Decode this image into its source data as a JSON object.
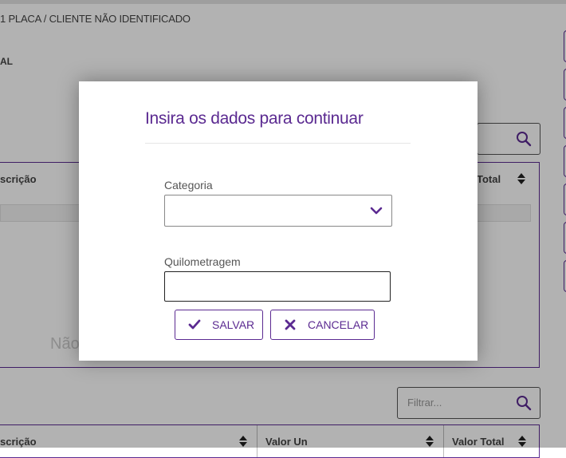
{
  "header": {
    "breadcrumb": "1 PLACA / CLIENTE NÃO IDENTIFICADO",
    "section_label": "AL"
  },
  "table1": {
    "col_desc": "scrição",
    "col_total": "Total",
    "empty_text": "Não"
  },
  "filter": {
    "placeholder": "Filtrar..."
  },
  "table2": {
    "col_desc": "scrição",
    "col_unit": "Valor Un",
    "col_total": "Valor Total"
  },
  "modal": {
    "title": "Insira os dados para continuar",
    "category_label": "Categoria",
    "category_value": "",
    "mileage_label": "Quilometragem",
    "mileage_value": "",
    "save_label": "SALVAR",
    "cancel_label": "CANCELAR"
  },
  "colors": {
    "accent": "#5b2a91",
    "overlay": "rgba(0,0,0,0.30)"
  },
  "icons": [
    "search-icon",
    "sort-icon",
    "chevron-down-icon",
    "check-icon",
    "close-icon"
  ]
}
